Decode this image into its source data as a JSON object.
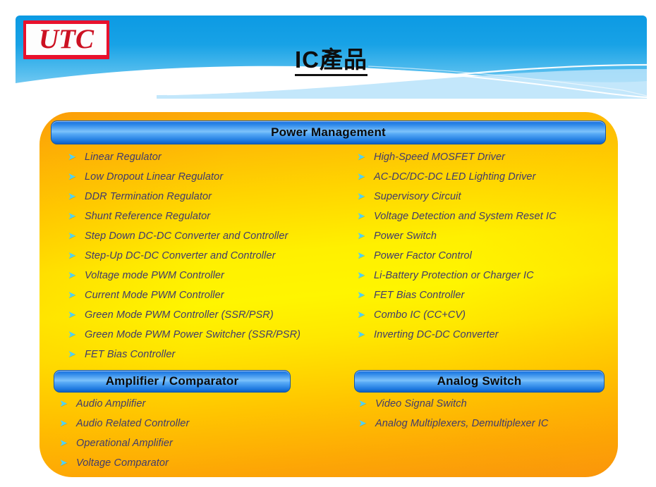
{
  "header": {
    "logo_text": "UTC",
    "title": "IC產品"
  },
  "panel": {
    "sections": [
      {
        "id": "power-management",
        "title": "Power Management",
        "columns": [
          {
            "items": [
              "Linear  Regulator",
              "Low Dropout Linear Regulator",
              "DDR  Termination Regulator",
              "Shunt Reference Regulator",
              "Step Down DC-DC Converter and Controller",
              "Step-Up DC-DC Converter and Controller",
              "Voltage mode PWM Controller",
              "Current Mode PWM Controller",
              "Green Mode PWM Controller (SSR/PSR)",
              "Green Mode PWM Power Switcher (SSR/PSR)",
              "FET Bias Controller"
            ]
          },
          {
            "items": [
              "High-Speed MOSFET Driver",
              "AC-DC/DC-DC LED Lighting Driver",
              "Supervisory Circuit",
              "Voltage Detection and System Reset IC",
              "Power Switch",
              "Power Factor Control",
              "Li-Battery Protection or Charger IC",
              "FET Bias Controller",
              "Combo IC (CC+CV)",
              "Inverting DC-DC Converter"
            ]
          }
        ]
      },
      {
        "id": "amplifier-comparator",
        "title": "Amplifier / Comparator",
        "columns": [
          {
            "items": [
              "Audio Amplifier",
              "Audio Related Controller",
              "Operational Amplifier",
              "Voltage Comparator"
            ]
          }
        ]
      },
      {
        "id": "analog-switch",
        "title": "Analog Switch",
        "columns": [
          {
            "items": [
              "Video Signal Switch",
              " Analog Multiplexers, Demultiplexer IC"
            ]
          }
        ]
      }
    ]
  },
  "icons": {
    "bullet": "➤"
  },
  "colors": {
    "banner_blue_top": "#0c9ae3",
    "banner_blue_bottom": "#93d6f6",
    "panel_orange": "#fba20b",
    "panel_yellow": "#fff500",
    "bar_blue": "#2b86e8",
    "bullet_cyan": "#4fd2f7",
    "list_text": "#3f3a6e",
    "logo_red": "#cc1122"
  }
}
